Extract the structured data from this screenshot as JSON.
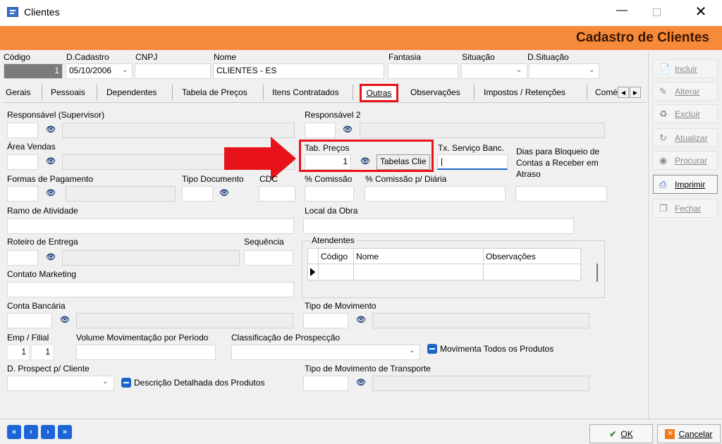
{
  "window": {
    "title": "Clientes"
  },
  "header": {
    "title": "Cadastro de Clientes"
  },
  "top_fields": {
    "codigo_label": "Código",
    "codigo_value": "1",
    "dcadastro_label": "D.Cadastro",
    "dcadastro_value": "05/10/2006",
    "cnpj_label": "CNPJ",
    "cnpj_value": "",
    "nome_label": "Nome",
    "nome_value": "CLIENTES - ES",
    "fantasia_label": "Fantasia",
    "fantasia_value": "",
    "situacao_label": "Situação",
    "situacao_value": "",
    "dsituacao_label": "D.Situação",
    "dsituacao_value": ""
  },
  "tabs": [
    "Gerais",
    "Pessoais",
    "Dependentes",
    "Tabela de Preços",
    "Itens Contratados",
    "Outras",
    "Observações",
    "Impostos / Retenções",
    "Comé"
  ],
  "active_tab": "Outras",
  "side_buttons": [
    {
      "label": "Incluir",
      "icon": "document-icon"
    },
    {
      "label": "Alterar",
      "icon": "pencil-icon"
    },
    {
      "label": "Excluir",
      "icon": "trash-icon"
    },
    {
      "label": "Atualizar",
      "icon": "refresh-icon"
    },
    {
      "label": "Procurar",
      "icon": "binoculars-icon"
    },
    {
      "label": "Imprimir",
      "icon": "printer-icon"
    },
    {
      "label": "Fechar",
      "icon": "close-folder-icon"
    }
  ],
  "form": {
    "responsavel_supervisor": "Responsável (Supervisor)",
    "responsavel2": "Responsável 2",
    "area_vendas": "Área Vendas",
    "tab_precos": "Tab. Preços",
    "tab_precos_value": "1",
    "tab_precos_desc": "Tabelas Clie",
    "tx_servico": "Tx. Serviço Banc.",
    "dias_bloqueio": "Dias para Bloqueio de Contas a Receber em Atraso",
    "formas_pagamento": "Formas de Pagamento",
    "tipo_documento": "Tipo Documento",
    "cdc": "CDC",
    "comissao": "% Comissão",
    "comissao_diaria": "% Comissão p/ Diária",
    "ramo_atividade": "Ramo de Atividade",
    "local_obra": "Local da Obra",
    "roteiro_entrega": "Roteiro de Entrega",
    "sequencia": "Sequência",
    "atendentes": "Atendentes",
    "atendentes_cols": [
      "Código",
      "Nome",
      "Observações"
    ],
    "contato_marketing": "Contato Marketing",
    "conta_bancaria": "Conta Bancária",
    "tipo_movimento": "Tipo de Movimento",
    "emp_filial": "Emp / Filial",
    "emp_value": "1",
    "filial_value": "1",
    "volume_mov": "Volume Movimentação por Período",
    "classificacao": "Classificação de Prospecção",
    "movimenta_todos": "Movimenta Todos os Produtos",
    "d_prospect": "D. Prospect p/ Cliente",
    "descricao_detalhada": "Descrição Detalhada dos Produtos",
    "tipo_mov_transporte": "Tipo de Movimento de Transporte"
  },
  "footer": {
    "ok_label": "OK",
    "cancel_label": "Cancelar"
  },
  "colors": {
    "banner": "#f58a3a",
    "highlight": "#e8121b",
    "accent": "#1c64c8"
  }
}
